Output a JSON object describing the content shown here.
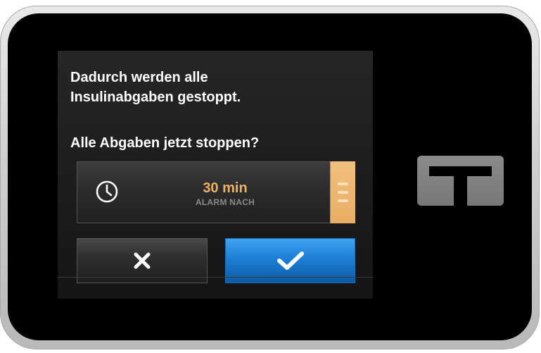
{
  "dialog": {
    "message_line1": "Dadurch werden alle",
    "message_line2": "Insulinabgaben gestoppt.",
    "question": "Alle Abgaben jetzt stoppen?"
  },
  "timer": {
    "icon": "clock-icon",
    "value": "30 min",
    "caption": "ALARM NACH",
    "accent_color": "#f0b062"
  },
  "buttons": {
    "cancel_icon": "close-icon",
    "confirm_icon": "checkmark-icon",
    "confirm_color": "#1d7fd6"
  },
  "device": {
    "logo_icon": "tandem-t-logo"
  }
}
